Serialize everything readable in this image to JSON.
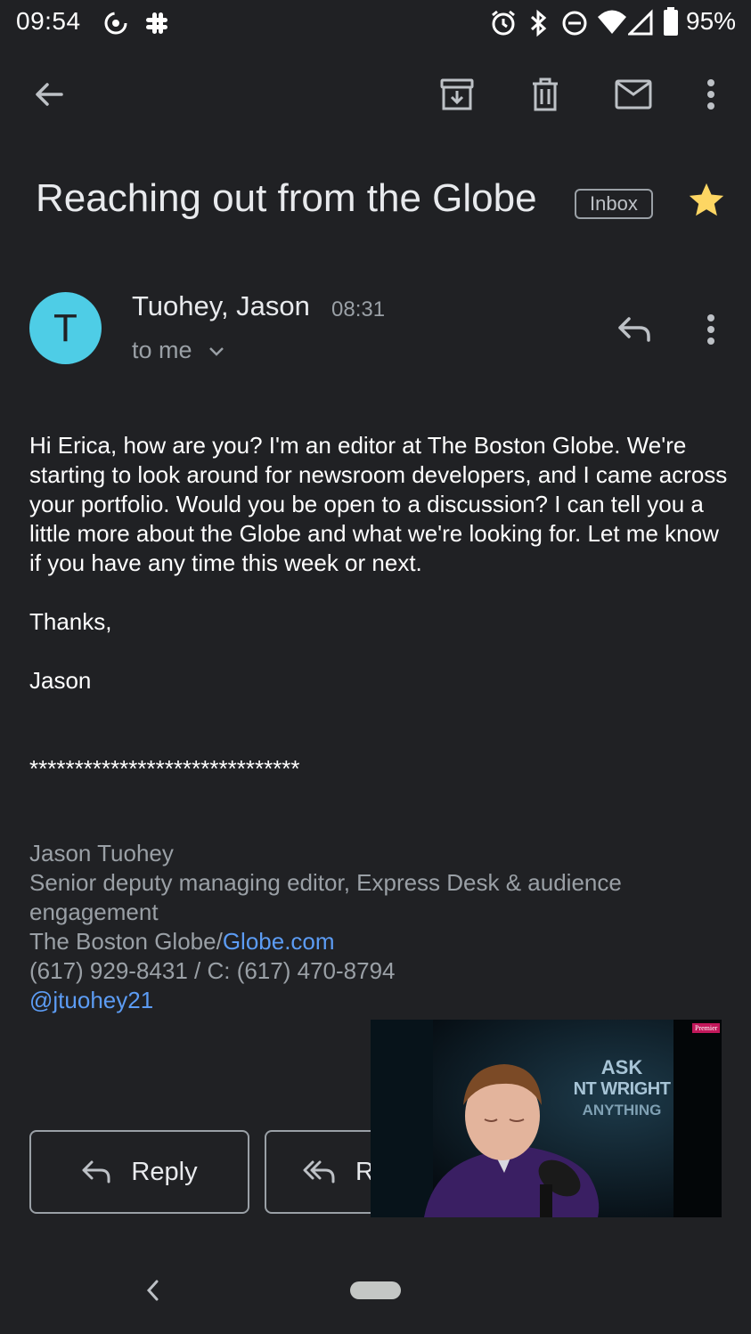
{
  "status_bar": {
    "time": "09:54",
    "battery": "95%"
  },
  "toolbar": {
    "back_icon": "arrow-back",
    "archive_icon": "archive",
    "delete_icon": "trash",
    "mark_unread_icon": "mail",
    "more_icon": "more-vert"
  },
  "email": {
    "subject": "Reaching out from the Globe",
    "label": "Inbox",
    "starred": true,
    "sender_initial": "T",
    "sender_name": "Tuohey, Jason",
    "time": "08:31",
    "recipient": "to me",
    "avatar_color": "#4ecde6",
    "body": {
      "paragraph": "Hi Erica, how are you? I'm an editor at The Boston Globe. We're starting to look around for newsroom developers, and I came across your portfolio. Would you be open to a discussion? I can tell you a little more about the Globe and what we're looking for. Let me know if you have any time this week or next.",
      "thanks": "Thanks,",
      "name": "Jason",
      "separator": "******************************"
    },
    "signature": {
      "name": "Jason Tuohey",
      "title_line1": "Senior deputy managing editor, Express Desk & audience",
      "title_line2": "engagement",
      "org": "The Boston Globe/",
      "org_link": "Globe.com",
      "phone": "(617) 929-8431 / C: (617) 470-8794",
      "handle": "@jtuohey21"
    }
  },
  "actions": {
    "reply": "Reply",
    "reply_all_visible": "R"
  },
  "pip_video": {
    "badge": "Premier",
    "sign_line1": "ASK",
    "sign_line2": "NT WRIGHT",
    "sign_line3": "ANYTHING"
  },
  "colors": {
    "background": "#202124",
    "star": "#fdd663",
    "link": "#5c9cf4"
  }
}
